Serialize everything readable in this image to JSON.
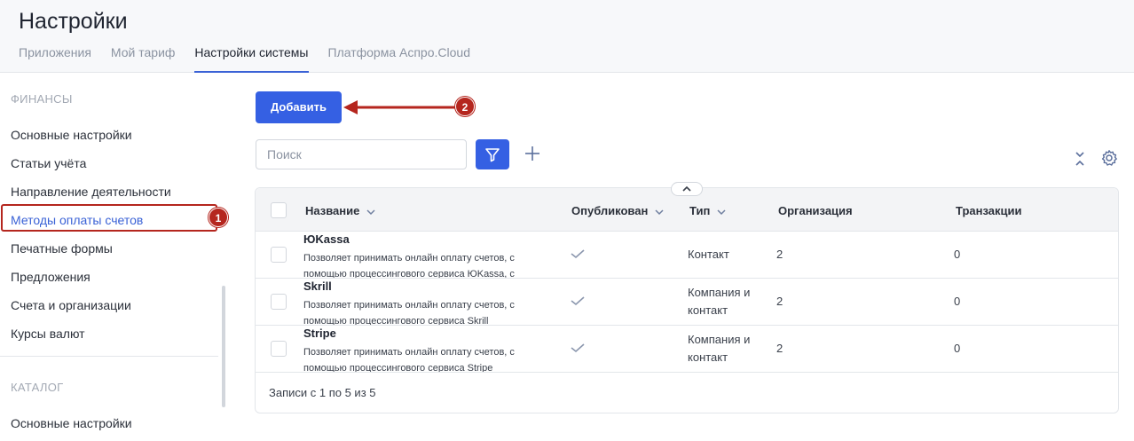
{
  "header": {
    "title": "Настройки",
    "tabs": [
      {
        "label": "Приложения"
      },
      {
        "label": "Мой тариф"
      },
      {
        "label": "Настройки системы"
      },
      {
        "label": "Платформа Аспро.Cloud"
      }
    ]
  },
  "sidebar": {
    "finance_title": "ФИНАНСЫ",
    "items": [
      {
        "label": "Основные настройки"
      },
      {
        "label": "Статьи учёта"
      },
      {
        "label": "Направление деятельности"
      },
      {
        "label": "Методы оплаты счетов"
      },
      {
        "label": "Печатные формы"
      },
      {
        "label": "Предложения"
      },
      {
        "label": "Счета и организации"
      },
      {
        "label": "Курсы валют"
      }
    ],
    "catalog_title": "КАТАЛОГ",
    "catalog_items": [
      {
        "label": "Основные настройки"
      }
    ]
  },
  "annotations": {
    "badge1": "1",
    "badge2": "2",
    "color": "#b5261e"
  },
  "toolbar": {
    "add_label": "Добавить",
    "search_placeholder": "Поиск"
  },
  "table": {
    "columns": {
      "name": "Название",
      "published": "Опубликован",
      "type": "Тип",
      "org": "Организация",
      "transactions": "Транзакции"
    },
    "rows": [
      {
        "name": "ЮKassa",
        "desc": "Позволяет принимать онлайн оплату счетов, с помощью процессингового сервиса ЮKassa, с",
        "type": "Контакт",
        "org": "2",
        "transactions": "0"
      },
      {
        "name": "Skrill",
        "desc": "Позволяет принимать онлайн оплату счетов, с помощью процессингового сервиса Skrill",
        "type": "Компания и контакт",
        "org": "2",
        "transactions": "0"
      },
      {
        "name": "Stripe",
        "desc": "Позволяет принимать онлайн оплату счетов, с помощью процессингового сервиса Stripe",
        "type": "Компания и контакт",
        "org": "2",
        "transactions": "0"
      }
    ],
    "footer": "Записи с 1 по 5 из 5"
  },
  "colors": {
    "accent": "#3560e3",
    "active_tab_underline": "#3a62d6"
  }
}
